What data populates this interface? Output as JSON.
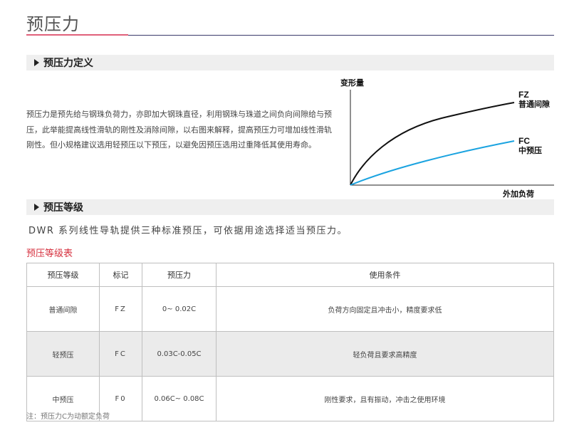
{
  "page": {
    "title": "预压力"
  },
  "section1": {
    "title": "预压力定义"
  },
  "description": "预压力是预先给与钢珠负荷力，亦即加大钢珠直径，利用钢珠与珠道之间负向间隙给与预压，此举能提高线性滑轨的刚性及消除间隙，以右图来解释，提高预压力可增加线性滑轨刚性。但小规格建议选用轻预压以下预压，以避免因预压选用过重降低其使用寿命。",
  "chart": {
    "y_label": "变形量",
    "x_label": "外加负荷",
    "fz_code": "FZ",
    "fz_name": "普通间隙",
    "fc_code": "FC",
    "fc_name": "中预压",
    "colors": {
      "fz": "#111111",
      "fc": "#1aa3e0"
    }
  },
  "section2": {
    "title": "预压等级"
  },
  "intro": "DWR 系列线性导轨提供三种标准预压，可依据用途选择适当预压力。",
  "table": {
    "caption": "预压等级表",
    "headers": [
      "预压等级",
      "标记",
      "预压力",
      "使用条件"
    ],
    "rows": [
      [
        "普通间隙",
        "FZ",
        "0~ 0.02C",
        "负荷方向固定且冲击小，精度要求低"
      ],
      [
        "轻预压",
        "FC",
        "0.03C-0.05C",
        "轻负荷且要求高精度"
      ],
      [
        "中预压",
        "F0",
        "0.06C~ 0.08C",
        "刚性要求，且有振动，冲击之使用环境"
      ]
    ]
  },
  "note": "注：预压力C为动额定负荷"
}
